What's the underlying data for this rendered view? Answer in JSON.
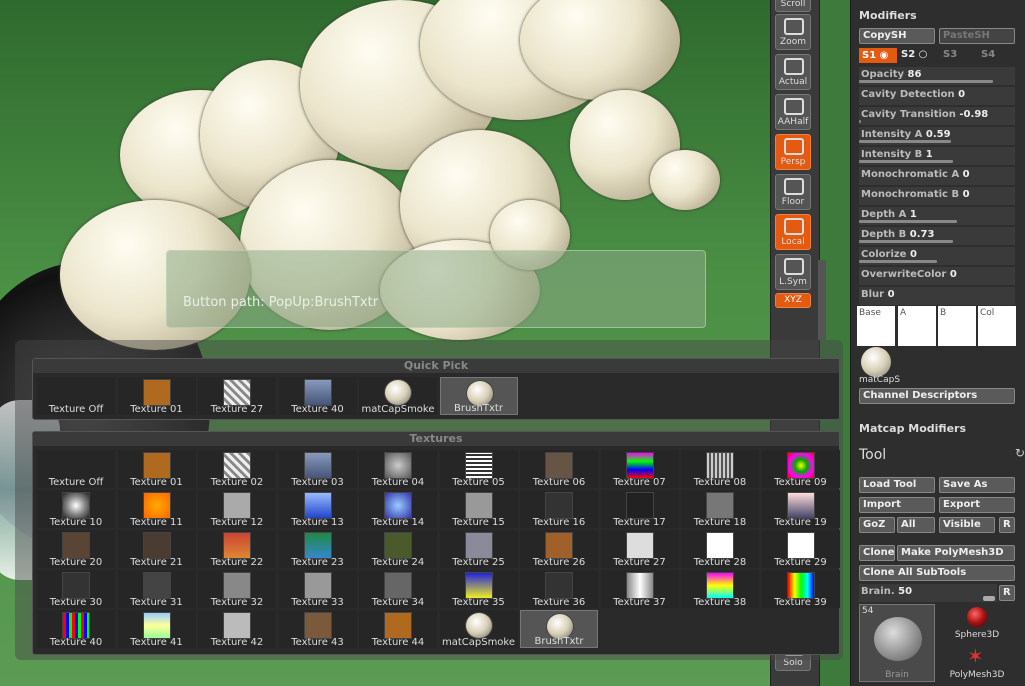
{
  "tooltip": "Button path: PopUp:BrushTxtr",
  "vstrip": [
    {
      "label": "Scroll",
      "icon": "scroll-icon",
      "active": false
    },
    {
      "label": "Zoom",
      "icon": "zoom-icon",
      "active": false
    },
    {
      "label": "Actual",
      "icon": "actual-icon",
      "active": false
    },
    {
      "label": "AAHalf",
      "icon": "aahalf-icon",
      "active": false
    },
    {
      "label": "Persp",
      "icon": "persp-icon",
      "active": true
    },
    {
      "label": "Floor",
      "icon": "floor-icon",
      "active": false
    },
    {
      "label": "Local",
      "icon": "local-icon",
      "active": true
    },
    {
      "label": "L.Sym",
      "icon": "lsym-icon",
      "active": false
    },
    {
      "label": "Solo",
      "icon": "solo-icon",
      "active": false
    }
  ],
  "xyz": "XYZ",
  "modifiers": {
    "title": "Modifiers",
    "copysh": "CopySH",
    "pastesh": "PasteSH",
    "s1": "S1",
    "s2": "S2",
    "s3": "S3",
    "s4": "S4",
    "sliders": [
      {
        "label": "Opacity",
        "value": "86",
        "fill": 0.86
      },
      {
        "label": "Cavity Detection",
        "value": "0",
        "fill": 0
      },
      {
        "label": "Cavity Transition",
        "value": "-0.98",
        "fill": 0.01
      },
      {
        "label": "Intensity A",
        "value": "0.59",
        "fill": 0.59
      },
      {
        "label": "Intensity B",
        "value": "1",
        "fill": 0.6
      },
      {
        "label": "Monochromatic A",
        "value": "0",
        "fill": 0
      },
      {
        "label": "Monochromatic B",
        "value": "0",
        "fill": 0
      },
      {
        "label": "Depth A",
        "value": "1",
        "fill": 0.63
      },
      {
        "label": "Depth B",
        "value": "0.73",
        "fill": 0.6
      },
      {
        "label": "Colorize",
        "value": "0",
        "fill": 0.5
      },
      {
        "label": "OverwriteColor",
        "value": "0",
        "fill": 0
      },
      {
        "label": "Blur",
        "value": "0",
        "fill": 0
      }
    ],
    "channels": [
      "Base",
      "A",
      "B",
      "Col"
    ],
    "matcap_label": "matCapS",
    "channel_descriptors": "Channel Descriptors",
    "matcap_modifiers": "Matcap Modifiers"
  },
  "tool": {
    "title": "Tool",
    "load": "Load Tool",
    "save": "Save As",
    "import": "Import",
    "export": "Export",
    "goz": "GoZ",
    "all": "All",
    "visible": "Visible",
    "r": "R",
    "clone": "Clone",
    "make_poly": "Make PolyMesh3D",
    "clone_all": "Clone All SubTools",
    "brain_label": "Brain.",
    "brain_value": "50",
    "count": "54",
    "items": [
      "Brain",
      "Sphere3D",
      "PolyMesh3D"
    ]
  },
  "quickpick": {
    "title": "Quick Pick",
    "items": [
      "Texture Off",
      "Texture 01",
      "Texture 27",
      "Texture 40",
      "matCapSmoke",
      "BrushTxtr"
    ]
  },
  "textures": {
    "title": "Textures",
    "items": [
      "Texture Off",
      "Texture 01",
      "Texture 02",
      "Texture 03",
      "Texture 04",
      "Texture 05",
      "Texture 06",
      "Texture 07",
      "Texture 08",
      "Texture 09",
      "Texture 10",
      "Texture 11",
      "Texture 12",
      "Texture 13",
      "Texture 14",
      "Texture 15",
      "Texture 16",
      "Texture 17",
      "Texture 18",
      "Texture 19",
      "Texture 20",
      "Texture 21",
      "Texture 22",
      "Texture 23",
      "Texture 24",
      "Texture 25",
      "Texture 26",
      "Texture 27",
      "Texture 28",
      "Texture 29",
      "Texture 30",
      "Texture 31",
      "Texture 32",
      "Texture 33",
      "Texture 34",
      "Texture 35",
      "Texture 36",
      "Texture 37",
      "Texture 38",
      "Texture 39",
      "Texture 40",
      "Texture 41",
      "Texture 42",
      "Texture 43",
      "Texture 44",
      "matCapSmoke",
      "BrushTxtr"
    ]
  }
}
